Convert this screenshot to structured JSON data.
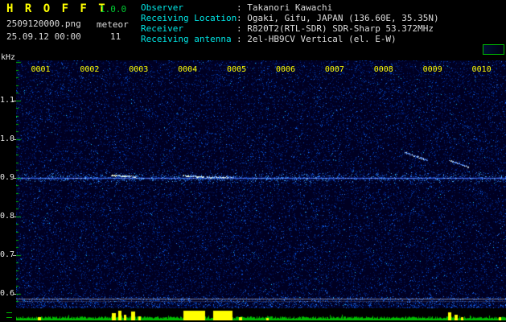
{
  "header": {
    "app_title": "H R O F F T",
    "version": "1.0.0",
    "filename": "2509120000.png",
    "mode": "meteor",
    "datetime": "25.09.12 00:00",
    "count": "11",
    "sep": ": ",
    "info": [
      {
        "label": "Observer",
        "value": "Takanori Kawachi"
      },
      {
        "label": "Receiving Location",
        "value": "Ogaki, Gifu, JAPAN (136.60E, 35.35N)"
      },
      {
        "label": "Receiver",
        "value": "R820T2(RTL-SDR) SDR-Sharp 53.372MHz"
      },
      {
        "label": "Receiving antenna",
        "value": "2el-HB9CV Vertical (el. E-W)"
      }
    ]
  },
  "colors": {
    "title_yellow": "#ffff00",
    "version_green": "#00cc33",
    "label_cyan": "#00e5e5",
    "value_white": "#dcdcdc",
    "axis_green": "#00bb00",
    "time_label_yellow": "#ffff00",
    "spike_yellow": "#ffff00",
    "noise_blue": "#002b99"
  },
  "chart_data": {
    "type": "heatmap",
    "title": "HROFFT 10-minute meteor radio observation spectrogram",
    "ylabel": "kHz",
    "xtick_labels": [
      "0001",
      "0002",
      "0003",
      "0004",
      "0005",
      "0006",
      "0007",
      "0008",
      "0009",
      "0010"
    ],
    "ytick_labels": [
      "1.1",
      "1.0",
      "0.9",
      "0.8",
      "0.7",
      "0.6"
    ],
    "ytick_values": [
      1.1,
      1.0,
      0.9,
      0.8,
      0.7,
      0.6
    ],
    "time_span_min": 10,
    "freq_top_khz": 1.204,
    "freq_bottom_khz": 0.562,
    "carrier_khz": 0.9,
    "reference_line_khz": 0.587,
    "meteor_echoes": [
      {
        "t_min": 1.95,
        "dur_min": 0.5,
        "f_khz": 0.906,
        "drift_khz": -0.004,
        "brightness": 1.0
      },
      {
        "t_min": 3.4,
        "dur_min": 0.45,
        "f_khz": 0.905,
        "drift_khz": -0.003,
        "brightness": 1.0
      },
      {
        "t_min": 3.9,
        "dur_min": 0.55,
        "f_khz": 0.901,
        "drift_khz": 0.0,
        "brightness": 0.6
      },
      {
        "t_min": 7.95,
        "dur_min": 0.45,
        "f_khz": 0.965,
        "drift_khz": -0.02,
        "brightness": 0.5
      },
      {
        "t_min": 8.85,
        "dur_min": 0.4,
        "f_khz": 0.945,
        "drift_khz": -0.018,
        "brightness": 0.5
      }
    ],
    "level_spikes": [
      {
        "t_min": 0.45,
        "w_min": 0.06,
        "h": 0.3
      },
      {
        "t_min": 1.95,
        "w_min": 0.08,
        "h": 0.75
      },
      {
        "t_min": 2.08,
        "w_min": 0.06,
        "h": 1.0
      },
      {
        "t_min": 2.2,
        "w_min": 0.05,
        "h": 0.6
      },
      {
        "t_min": 2.35,
        "w_min": 0.08,
        "h": 0.9
      },
      {
        "t_min": 2.5,
        "w_min": 0.05,
        "h": 0.45
      },
      {
        "t_min": 3.42,
        "w_min": 0.45,
        "h": 1.0
      },
      {
        "t_min": 4.02,
        "w_min": 0.4,
        "h": 1.0
      },
      {
        "t_min": 4.55,
        "w_min": 0.06,
        "h": 0.35
      },
      {
        "t_min": 5.1,
        "w_min": 0.05,
        "h": 0.25
      },
      {
        "t_min": 8.82,
        "w_min": 0.07,
        "h": 0.85
      },
      {
        "t_min": 8.95,
        "w_min": 0.06,
        "h": 0.6
      },
      {
        "t_min": 9.08,
        "w_min": 0.05,
        "h": 0.35
      },
      {
        "t_min": 9.85,
        "w_min": 0.05,
        "h": 0.3
      }
    ]
  }
}
